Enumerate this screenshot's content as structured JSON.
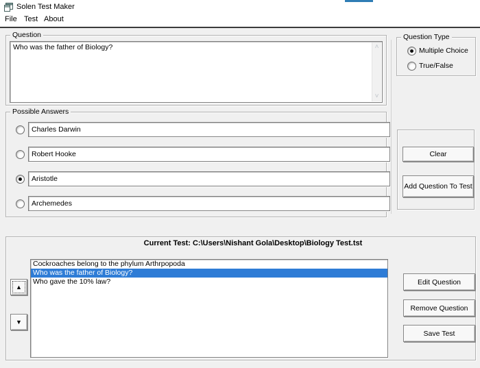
{
  "window": {
    "title": "Solen Test Maker"
  },
  "menu": {
    "items": [
      {
        "label": "File"
      },
      {
        "label": "Test"
      },
      {
        "label": "About"
      }
    ]
  },
  "question_group": {
    "caption": "Question",
    "text": "Who was the father of Biology?"
  },
  "question_type_group": {
    "caption": "Question Type",
    "options": [
      {
        "label": "Multiple Choice",
        "selected": true
      },
      {
        "label": "True/False",
        "selected": false
      }
    ]
  },
  "answers_group": {
    "caption": "Possible Answers",
    "answers": [
      {
        "text": "Charles Darwin",
        "selected": false
      },
      {
        "text": "Robert Hooke",
        "selected": false
      },
      {
        "text": "Aristotle",
        "selected": true
      },
      {
        "text": "Archemedes",
        "selected": false
      }
    ]
  },
  "action_buttons": {
    "clear": "Clear",
    "add": "Add Question To Test"
  },
  "test_panel": {
    "title": "Current Test: C:\\Users\\Nishant Gola\\Desktop\\Biology Test.tst",
    "items": [
      {
        "text": "Cockroaches belong to the phylum Arthrpopoda",
        "selected": false
      },
      {
        "text": "Who was the father of Biology?",
        "selected": true
      },
      {
        "text": "Who gave the 10% law?",
        "selected": false
      }
    ],
    "edit": "Edit Question",
    "remove": "Remove Question",
    "save": "Save Test"
  },
  "icons": {
    "move_up": "▲",
    "move_down": "▼",
    "scroll_up": "˄",
    "scroll_down": "˅"
  },
  "colors": {
    "selection": "#2e7cd6",
    "top_fragment": "#2f7db5"
  }
}
